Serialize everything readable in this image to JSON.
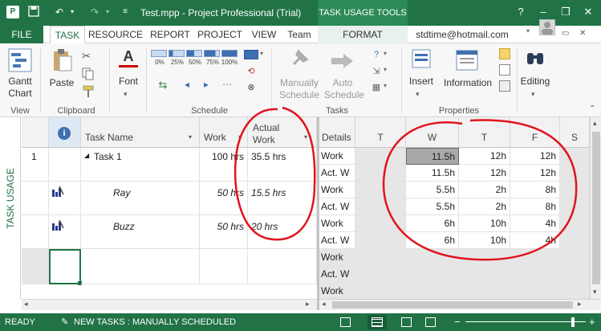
{
  "title_bar": {
    "title": "Test.mpp - Project Professional (Trial)",
    "context_group": "TASK USAGE TOOLS",
    "help": "?",
    "minimize": "–",
    "restore": "❐",
    "close": "✕"
  },
  "tabs": {
    "file": "FILE",
    "task": "TASK",
    "resource": "RESOURCE",
    "report": "REPORT",
    "project": "PROJECT",
    "view": "VIEW",
    "team": "Team",
    "format": "FORMAT",
    "user": "stdtime@hotmail.com"
  },
  "ribbon": {
    "gantt_chart": "Gantt\nChart",
    "gantt_line1": "Gantt",
    "gantt_line2": "Chart",
    "paste": "Paste",
    "font": "Font",
    "manually_1": "Manually",
    "manually_2": "Schedule",
    "auto_1": "Auto",
    "auto_2": "Schedule",
    "insert": "Insert",
    "information": "Information",
    "editing": "Editing",
    "pct": [
      "0%",
      "25%",
      "50%",
      "75%",
      "100%"
    ],
    "groups": {
      "view": "View",
      "clipboard": "Clipboard",
      "schedule": "Schedule",
      "tasks": "Tasks",
      "properties": "Properties"
    },
    "colors": {
      "accent": "#217346",
      "annotation": "#e0141e"
    }
  },
  "left_vtab": "TASK USAGE",
  "table": {
    "headers": {
      "info": "i",
      "task_name": "Task Name",
      "work": "Work",
      "actual_1": "Actual",
      "actual_2": "Work"
    },
    "rows": [
      {
        "id": "1",
        "name": "Task 1",
        "work": "100 hrs",
        "actual": "35.5 hrs"
      },
      {
        "id": "",
        "name": "Ray",
        "work": "50 hrs",
        "actual": "15.5 hrs"
      },
      {
        "id": "",
        "name": "Buzz",
        "work": "50 hrs",
        "actual": "20 hrs"
      }
    ]
  },
  "timephased": {
    "headers": {
      "details": "Details",
      "days": [
        "T",
        "W",
        "T",
        "F",
        "S"
      ]
    },
    "rows": [
      {
        "label": "Work",
        "values": [
          "",
          "11.5h",
          "12h",
          "12h"
        ]
      },
      {
        "label": "Act. W",
        "values": [
          "",
          "11.5h",
          "12h",
          "12h"
        ]
      },
      {
        "label": "Work",
        "values": [
          "",
          "5.5h",
          "2h",
          "8h"
        ]
      },
      {
        "label": "Act. W",
        "values": [
          "",
          "5.5h",
          "2h",
          "8h"
        ]
      },
      {
        "label": "Work",
        "values": [
          "",
          "6h",
          "10h",
          "4h"
        ]
      },
      {
        "label": "Act. W",
        "values": [
          "",
          "6h",
          "10h",
          "4h"
        ]
      },
      {
        "label": "Work",
        "values": [
          "",
          "",
          "",
          ""
        ]
      },
      {
        "label": "Act. W",
        "values": [
          "",
          "",
          "",
          ""
        ]
      },
      {
        "label": "Work",
        "values": [
          "",
          "",
          "",
          ""
        ]
      }
    ]
  },
  "status": {
    "ready": "READY",
    "new_tasks": "NEW TASKS : MANUALLY SCHEDULED",
    "zoom_minus": "−",
    "zoom_plus": "+"
  }
}
